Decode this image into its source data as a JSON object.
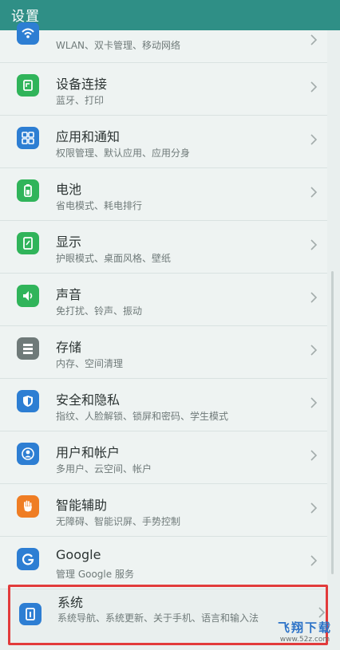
{
  "header": {
    "title": "设置"
  },
  "rows": [
    {
      "title": "",
      "subtitle": "WLAN、双卡管理、移动网络",
      "icon": "wifi-icon",
      "color": "#2d7ed3"
    },
    {
      "title": "设备连接",
      "subtitle": "蓝牙、打印",
      "icon": "device-connection-icon",
      "color": "#30b45a"
    },
    {
      "title": "应用和通知",
      "subtitle": "权限管理、默认应用、应用分身",
      "icon": "apps-icon",
      "color": "#2d7ed3"
    },
    {
      "title": "电池",
      "subtitle": "省电模式、耗电排行",
      "icon": "battery-icon",
      "color": "#30b45a"
    },
    {
      "title": "显示",
      "subtitle": "护眼模式、桌面风格、壁纸",
      "icon": "display-icon",
      "color": "#30b45a"
    },
    {
      "title": "声音",
      "subtitle": "免打扰、铃声、振动",
      "icon": "sound-icon",
      "color": "#30b45a"
    },
    {
      "title": "存储",
      "subtitle": "内存、空间清理",
      "icon": "storage-icon",
      "color": "#6f7a79"
    },
    {
      "title": "安全和隐私",
      "subtitle": "指纹、人脸解锁、锁屏和密码、学生模式",
      "icon": "shield-icon",
      "color": "#2d7ed3"
    },
    {
      "title": "用户和帐户",
      "subtitle": "多用户、云空间、帐户",
      "icon": "user-icon",
      "color": "#2d7ed3"
    },
    {
      "title": "智能辅助",
      "subtitle": "无障碍、智能识屏、手势控制",
      "icon": "hand-icon",
      "color": "#ef7d24"
    },
    {
      "title": "Google",
      "subtitle": "管理 Google 服务",
      "icon": "google-icon",
      "color": "#2d7ed3"
    }
  ],
  "system": {
    "title": "系统",
    "subtitle": "系统导航、系统更新、关于手机、语言和输入法",
    "icon": "system-icon",
    "color": "#2d7ed3"
  },
  "watermark": {
    "main": "飞翔下载",
    "sub": "www.52z.com"
  },
  "highlight_color": "#e23b3b"
}
